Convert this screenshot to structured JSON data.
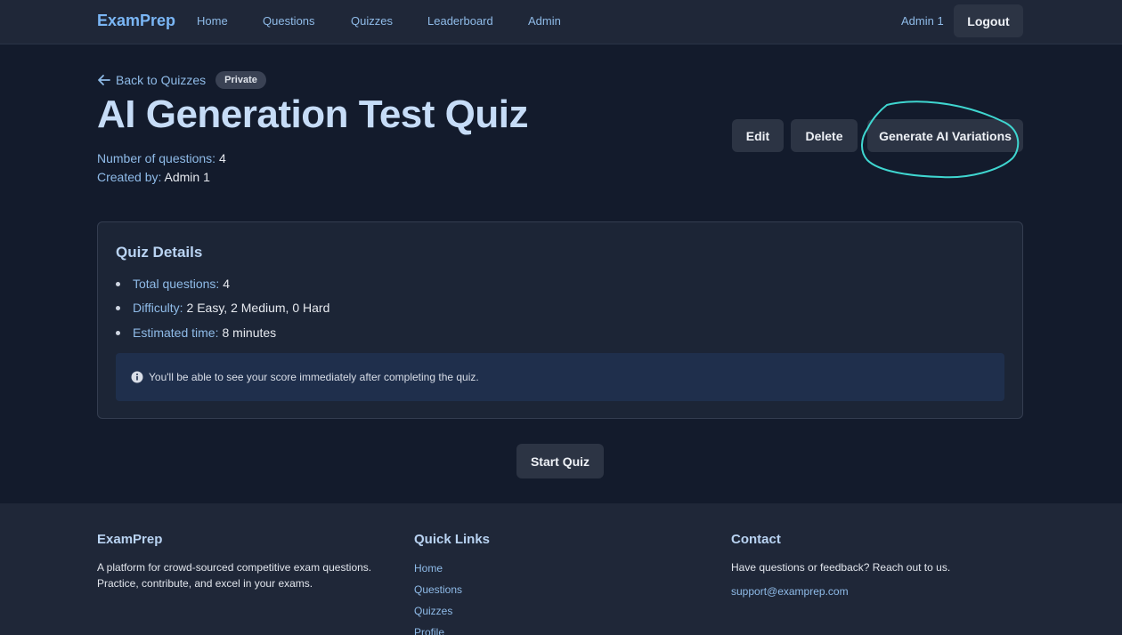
{
  "nav": {
    "brand": "ExamPrep",
    "links": [
      "Home",
      "Questions",
      "Quizzes",
      "Leaderboard",
      "Admin"
    ],
    "user": "Admin 1",
    "logout": "Logout"
  },
  "quiz": {
    "back_label": "Back to Quizzes",
    "visibility_badge": "Private",
    "title": "AI Generation Test Quiz",
    "num_questions_label": "Number of questions:",
    "num_questions_value": "4",
    "created_by_label": "Created by:",
    "created_by_value": "Admin 1",
    "actions": {
      "edit": "Edit",
      "delete": "Delete",
      "generate": "Generate AI Variations"
    }
  },
  "details": {
    "title": "Quiz Details",
    "items": [
      {
        "label": "Total questions:",
        "value": "4"
      },
      {
        "label": "Difficulty:",
        "value": "2 Easy, 2 Medium, 0 Hard"
      },
      {
        "label": "Estimated time:",
        "value": "8 minutes"
      }
    ],
    "info": "You'll be able to see your score immediately after completing the quiz."
  },
  "start_label": "Start Quiz",
  "footer": {
    "brand": {
      "title": "ExamPrep",
      "line1": "A platform for crowd-sourced competitive exam questions.",
      "line2": "Practice, contribute, and excel in your exams."
    },
    "quick_links": {
      "title": "Quick Links",
      "items": [
        "Home",
        "Questions",
        "Quizzes",
        "Profile"
      ]
    },
    "contact": {
      "title": "Contact",
      "text": "Have questions or feedback? Reach out to us.",
      "email": "support@examprep.com"
    }
  },
  "colors": {
    "background": "#131b2c",
    "accent": "#7ab6f5",
    "annotation": "#3fd6d0"
  },
  "icons": {
    "back": "arrow-left-icon",
    "info": "info-circle-icon"
  }
}
